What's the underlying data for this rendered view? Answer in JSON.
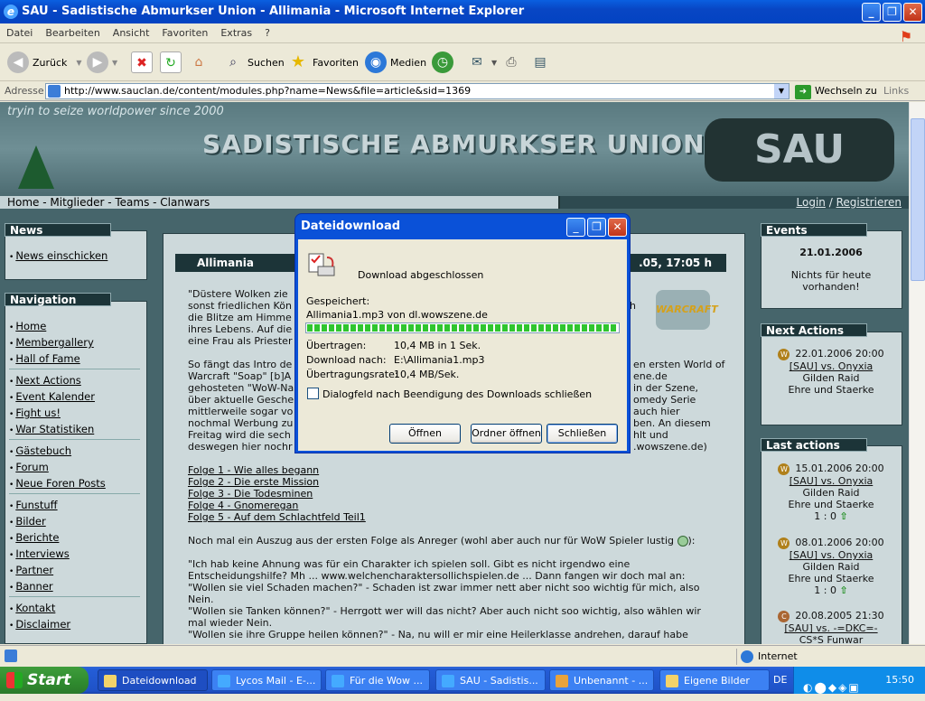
{
  "window": {
    "title": "SAU - Sadistische Abmurkser Union - Allimania - Microsoft Internet Explorer"
  },
  "menu": [
    "Datei",
    "Bearbeiten",
    "Ansicht",
    "Favoriten",
    "Extras",
    "?"
  ],
  "toolbar": {
    "back": "Zurück",
    "search": "Suchen",
    "favorites": "Favoriten",
    "media": "Medien"
  },
  "address": {
    "label": "Adresse",
    "url": "http://www.sauclan.de/content/modules.php?name=News&file=article&sid=1369",
    "go": "Wechseln zu",
    "links": "Links"
  },
  "banner": {
    "tagline": "tryin to seize worldpower since 2000",
    "title": "SADISTISCHE ABMURKSER UNION",
    "logo": "SAU"
  },
  "nav": {
    "main": "Home - Mitglieder - Teams - Clanwars",
    "login": "Login",
    "slash": "/",
    "register": "Registrieren"
  },
  "left": {
    "news_header": "News",
    "news_items": [
      "News einschicken"
    ],
    "nav_header": "Navigation",
    "groups": [
      [
        "Home",
        "Membergallery",
        "Hall of Fame"
      ],
      [
        "Next Actions",
        "Event Kalender",
        "Fight us!",
        "War Statistiken"
      ],
      [
        "Gästebuch",
        "Forum",
        "Neue Foren Posts"
      ],
      [
        "Funstuff",
        "Bilder",
        "Berichte",
        "Interviews",
        "Partner",
        "Banner"
      ],
      [
        "Kontakt",
        "Disclaimer"
      ]
    ]
  },
  "article": {
    "title": "Allimania",
    "date": ".05, 17:05 h",
    "wow_logo": "WARCRAFT",
    "p1": [
      "\"Düstere Wolken zie",
      "sonst friedlichen Kön",
      "die Blitze am Himme",
      "ihres Lebens. Auf die",
      "eine Frau als Priester"
    ],
    "p1r": [
      "h",
      ""
    ],
    "p2": [
      "So fängt das Intro de",
      "Warcraft \"Soap\" [b]A",
      "gehosteten \"WoW-Na",
      "über aktuelle Gesche",
      "mittlerweile sogar vo",
      "nochmal Werbung zu",
      "Freitag wird die sech",
      "deswegen hier nochr"
    ],
    "p2r": [
      "en ersten World of",
      "ene.de",
      "in der Szene,",
      "omedy Serie",
      "auch hier",
      "ben. An diesem",
      "hlt und",
      ".wowszene.de)"
    ],
    "links": [
      "Folge 1 - Wie alles begann",
      "Folge 2 - Die erste Mission",
      "Folge 3 - Die Todesminen",
      "Folge 4 - Gnomeregan",
      "Folge 5 - Auf dem Schlachtfeld Teil1"
    ],
    "excerpt": "Noch mal ein Auszug aus der ersten Folge als Anreger (wohl aber auch nur für WoW Spieler lustig",
    "excerpt_end": "):",
    "q": [
      "\"Ich hab keine Ahnung was für ein Charakter ich spielen soll. Gibt es nicht irgendwo eine",
      "Entscheidungshilfe? Mh ... www.welchencharaktersollichspielen.de ... Dann fangen wir doch mal an:",
      "\"Wollen sie viel Schaden machen?\" - Schaden ist zwar immer nett aber nicht soo wichtig für mich, also",
      "Nein.",
      "\"Wollen sie Tanken können?\" - Herrgott wer will das nicht? Aber auch nicht soo wichtig, also wählen wir",
      "mal wieder Nein.",
      "\"Wollen sie ihre Gruppe heilen können?\" - Na, nu will er mir eine Heilerklasse andrehen, darauf habe"
    ]
  },
  "right": {
    "events_header": "Events",
    "events_date": "21.01.2006",
    "events_text1": "Nichts für heute",
    "events_text2": "vorhanden!",
    "next_header": "Next Actions",
    "next": {
      "date": "22.01.2006 20:00",
      "match": "[SAU] vs. Onyxia",
      "team": "Gilden Raid",
      "note": "Ehre und Staerke"
    },
    "last_header": "Last actions",
    "last": [
      {
        "date": "15.01.2006 20:00",
        "match": "[SAU] vs. Onyxia",
        "team": "Gilden Raid",
        "note": "Ehre und Staerke",
        "score": "1 : 0"
      },
      {
        "date": "08.01.2006 20:00",
        "match": "[SAU] vs. Onyxia",
        "team": "Gilden Raid",
        "note": "Ehre und Staerke",
        "score": "1 : 0"
      },
      {
        "date": "20.08.2005 21:30",
        "match": "[SAU] vs. -=DKC=-",
        "team": "CS*S Funwar",
        "note": "",
        "score": ""
      }
    ]
  },
  "dialog": {
    "title": "Dateidownload",
    "heading": "Download abgeschlossen",
    "saved_label": "Gespeichert:",
    "file_line": "Allimania1.mp3 von dl.wowszene.de",
    "progress_percent": 100,
    "rows": [
      {
        "label": "Übertragen:",
        "value": "10,4 MB in 1 Sek."
      },
      {
        "label": "Download nach:",
        "value": "E:\\Allimania1.mp3"
      },
      {
        "label": "Übertragungsrate:",
        "value": "10,4 MB/Sek."
      }
    ],
    "checkbox": "Dialogfeld nach Beendigung des Downloads schließen",
    "open": "Öffnen",
    "open_folder": "Ordner öffnen",
    "close": "Schließen"
  },
  "status": {
    "zone": "Internet"
  },
  "taskbar": {
    "start": "Start",
    "tasks": [
      "Dateidownload",
      "Lycos Mail - E-...",
      "Für die Wow ...",
      "SAU - Sadistis...",
      "Unbenannt - ...",
      "Eigene Bilder"
    ],
    "lang": "DE",
    "clock": "15:50"
  }
}
